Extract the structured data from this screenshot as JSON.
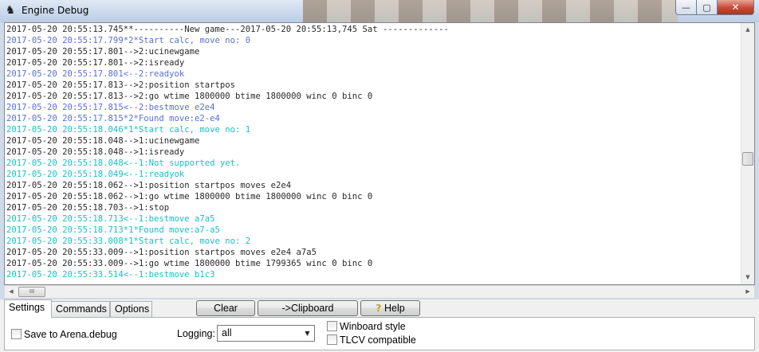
{
  "window": {
    "title": "Engine Debug",
    "app_icon": "arena-app-icon",
    "minimize_glyph": "—",
    "maximize_glyph": "▢",
    "close_glyph": "✕"
  },
  "colors": {
    "black_line": "#2a2a2a",
    "blue_line": "#5a6fd6",
    "cyan_line": "#19c0c2"
  },
  "log": {
    "lines": [
      {
        "text": "2017-05-20 20:55:13.745**----------New game---2017-05-20 20:55:13,745 Sat -------------",
        "color": "black"
      },
      {
        "text": "2017-05-20 20:55:17.799*2*Start calc, move no: 0",
        "color": "blue"
      },
      {
        "text": "2017-05-20 20:55:17.801-->2:ucinewgame",
        "color": "black"
      },
      {
        "text": "2017-05-20 20:55:17.801-->2:isready",
        "color": "black"
      },
      {
        "text": "2017-05-20 20:55:17.801<--2:readyok",
        "color": "blue"
      },
      {
        "text": "2017-05-20 20:55:17.813-->2:position startpos",
        "color": "black"
      },
      {
        "text": "2017-05-20 20:55:17.813-->2:go wtime 1800000 btime 1800000 winc 0 binc 0",
        "color": "black"
      },
      {
        "text": "2017-05-20 20:55:17.815<--2:bestmove e2e4",
        "color": "blue"
      },
      {
        "text": "2017-05-20 20:55:17.815*2*Found move:e2-e4",
        "color": "blue"
      },
      {
        "text": "2017-05-20 20:55:18.046*1*Start calc, move no: 1",
        "color": "cyan"
      },
      {
        "text": "2017-05-20 20:55:18.048-->1:ucinewgame",
        "color": "black"
      },
      {
        "text": "2017-05-20 20:55:18.048-->1:isready",
        "color": "black"
      },
      {
        "text": "2017-05-20 20:55:18.048<--1:Not supported yet.",
        "color": "cyan"
      },
      {
        "text": "2017-05-20 20:55:18.049<--1:readyok",
        "color": "cyan"
      },
      {
        "text": "2017-05-20 20:55:18.062-->1:position startpos moves e2e4",
        "color": "black"
      },
      {
        "text": "2017-05-20 20:55:18.062-->1:go wtime 1800000 btime 1800000 winc 0 binc 0",
        "color": "black"
      },
      {
        "text": "2017-05-20 20:55:18.703-->1:stop",
        "color": "black"
      },
      {
        "text": "2017-05-20 20:55:18.713<--1:bestmove a7a5",
        "color": "cyan"
      },
      {
        "text": "2017-05-20 20:55:18.713*1*Found move:a7-a5",
        "color": "cyan"
      },
      {
        "text": "2017-05-20 20:55:33.008*1*Start calc, move no: 2",
        "color": "cyan"
      },
      {
        "text": "2017-05-20 20:55:33.009-->1:position startpos moves e2e4 a7a5",
        "color": "black"
      },
      {
        "text": "2017-05-20 20:55:33.009-->1:go wtime 1800000 btime 1799365 winc 0 binc 0",
        "color": "black"
      },
      {
        "text": "2017-05-20 20:55:33.514<--1:bestmove b1c3",
        "color": "cyan"
      }
    ]
  },
  "scrollbars": {
    "up_glyph": "▲",
    "down_glyph": "▼",
    "left_glyph": "◀",
    "right_glyph": "▶",
    "thumb_grip": "III"
  },
  "tabs": [
    {
      "label": "Settings",
      "active": true
    },
    {
      "label": "Commands",
      "active": false
    },
    {
      "label": "Options",
      "active": false
    }
  ],
  "buttons": {
    "clear": "Clear",
    "clipboard": "->Clipboard",
    "help": "Help",
    "help_icon_glyph": "?"
  },
  "settings": {
    "save_to_file_label": "Save to Arena.debug",
    "save_to_file_checked": false,
    "logging_label": "Logging:",
    "logging_value": "all",
    "winboard_style_label": "Winboard style",
    "winboard_style_checked": false,
    "tlcv_label": "TLCV compatible",
    "tlcv_checked": false
  }
}
